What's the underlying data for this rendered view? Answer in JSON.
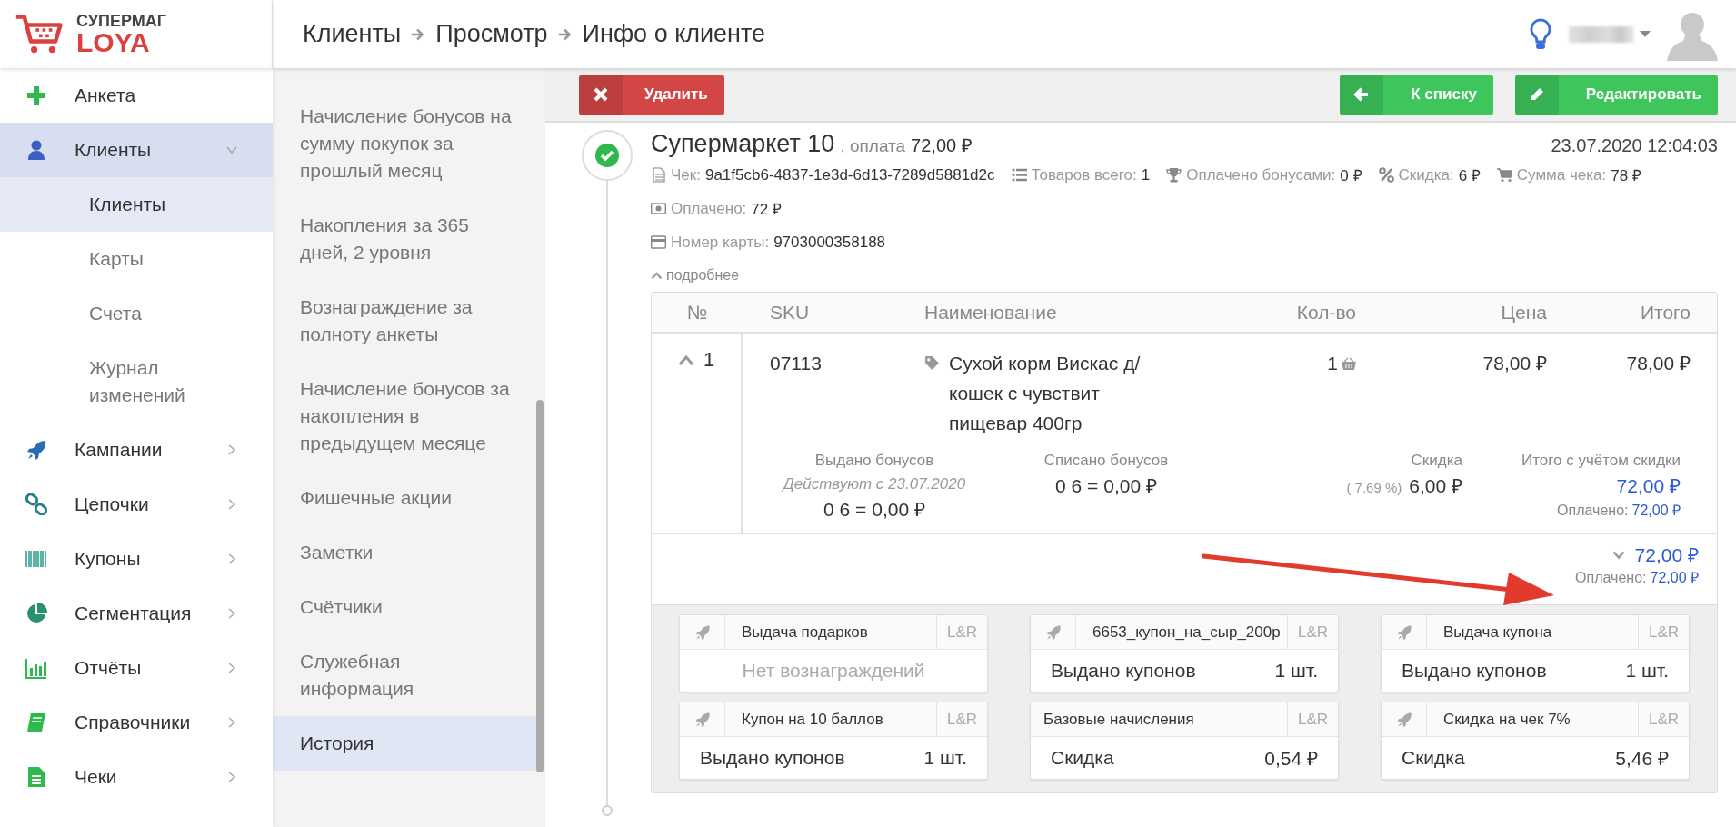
{
  "logo": {
    "brand": "СУПЕРМАГ",
    "product": "LOYA"
  },
  "breadcrumbs": [
    "Клиенты",
    "Просмотр",
    "Инфо о клиенте"
  ],
  "sidebar": {
    "items": [
      {
        "label": "Анкета",
        "selected": false
      },
      {
        "label": "Клиенты",
        "selected": true,
        "expanded": true,
        "children": [
          {
            "label": "Клиенты",
            "selected": true
          },
          {
            "label": "Карты",
            "selected": false
          },
          {
            "label": "Счета",
            "selected": false
          },
          {
            "label": "Журнал изменений",
            "selected": false
          }
        ]
      },
      {
        "label": "Кампании",
        "selected": false,
        "expanded": false
      },
      {
        "label": "Цепочки",
        "selected": false,
        "expanded": false
      },
      {
        "label": "Купоны",
        "selected": false,
        "expanded": false
      },
      {
        "label": "Сегментация",
        "selected": false,
        "expanded": false
      },
      {
        "label": "Отчёты",
        "selected": false,
        "expanded": false
      },
      {
        "label": "Справочники",
        "selected": false,
        "expanded": false
      },
      {
        "label": "Чеки",
        "selected": false,
        "expanded": false
      }
    ]
  },
  "sections": {
    "items": [
      {
        "label": "Начисление бонусов на сумму покупок за прошлый месяц",
        "selected": false
      },
      {
        "label": "Накопления за 365 дней, 2 уровня",
        "selected": false
      },
      {
        "label": "Вознаграждение за полноту анкеты",
        "selected": false
      },
      {
        "label": "Начисление бонусов за накопления в предыдущем месяце",
        "selected": false
      },
      {
        "label": "Фишечные акции",
        "selected": false
      },
      {
        "label": "Заметки",
        "selected": false
      },
      {
        "label": "Счётчики",
        "selected": false
      },
      {
        "label": "Служебная информация",
        "selected": false
      },
      {
        "label": "История",
        "selected": true
      }
    ]
  },
  "toolbar": {
    "buttons": [
      {
        "label": "Удалить",
        "kind": "danger"
      },
      {
        "label": "К списку",
        "kind": "success"
      },
      {
        "label": "Редактировать",
        "kind": "success"
      }
    ]
  },
  "receipt": {
    "store": "Супермаркет 10",
    "payment_label": ", оплата",
    "payment": "72,00 ₽",
    "datetime": "23.07.2020 12:04:03",
    "fact_rows": [
      {
        "items": [
          {
            "label": "Чек:",
            "value": "9a1f5cb6-4837-1e3d-6d13-7289d5881d2c"
          },
          {
            "label": "Товаров всего:",
            "value": "1"
          },
          {
            "label": "Оплачено бонусами:",
            "value": "0 ₽"
          },
          {
            "label": "Скидка:",
            "value": "6 ₽"
          },
          {
            "label": "Сумма чека:",
            "value": "78 ₽"
          }
        ]
      },
      {
        "items": [
          {
            "label": "Оплачено:",
            "value": "72 ₽"
          }
        ]
      },
      {
        "items": [
          {
            "label": "Номер карты:",
            "value": "9703000358188"
          }
        ]
      }
    ],
    "details": {
      "label": "подробнее",
      "expanded": true
    },
    "table": {
      "columns": [
        {
          "label": "№"
        },
        {
          "label": "SKU"
        },
        {
          "label": "Наименование"
        },
        {
          "label": "Кол-во"
        },
        {
          "label": "Цена"
        },
        {
          "label": "Итого"
        }
      ],
      "rows": [
        {
          "number": "1",
          "expanded": true,
          "sku": "07113",
          "name": "Сухой корм Вискас д/кошек с чувствит пищевар 400гр",
          "qty": "1",
          "price": "78,00 ₽",
          "total": "78,00 ₽",
          "issued": {
            "label": "Выдано бонусов",
            "note": "Действуют с 23.07.2020",
            "value": "0 6 = 0,00 ₽"
          },
          "written_off": {
            "label": "Списано бонусов",
            "value": "0 6 = 0,00 ₽"
          },
          "discount": {
            "label": "Скидка",
            "percent": "( 7.69 %)",
            "value": "6,00 ₽"
          },
          "discounted_total": {
            "label": "Итого с учётом скидки",
            "value": "72,00 ₽",
            "paid_label": "Оплачено:",
            "paid_value": "72,00 ₽"
          }
        }
      ]
    },
    "totals": {
      "expanded": false,
      "value": "72,00 ₽",
      "paid_label": "Оплачено:",
      "paid_value": "72,00 ₽"
    },
    "promotions": [
      {
        "title": "Выдача подарков",
        "tag": "L&R",
        "kind": "empty",
        "message": "Нет вознаграждений"
      },
      {
        "title": "6653_купон_на_сыр_200р",
        "tag": "L&R",
        "kind": "reward",
        "label": "Выдано купонов",
        "value": "1 шт."
      },
      {
        "title": "Выдача купона",
        "tag": "L&R",
        "kind": "reward",
        "label": "Выдано купонов",
        "value": "1 шт."
      },
      {
        "title": "Купон на 10 баллов",
        "tag": "L&R",
        "kind": "reward",
        "label": "Выдано купонов",
        "value": "1 шт."
      },
      {
        "title": "Базовые начисления",
        "tag": "L&R",
        "kind": "base",
        "label": "Скидка",
        "value": "0,54 ₽"
      },
      {
        "title": "Скидка на чек 7%",
        "tag": "L&R",
        "kind": "reward",
        "label": "Скидка",
        "value": "5,46 ₽"
      }
    ]
  }
}
